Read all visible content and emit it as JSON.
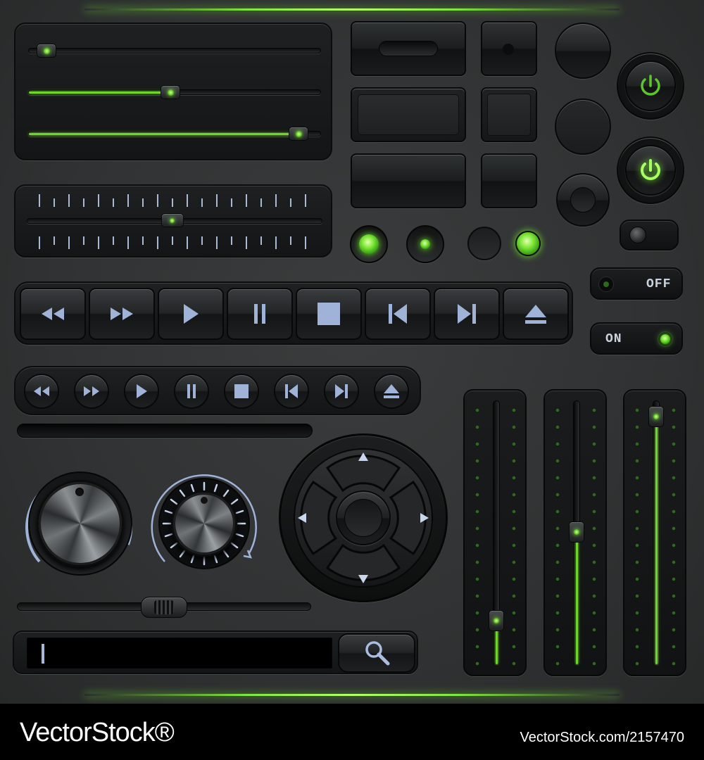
{
  "toggles": {
    "off_label": "OFF",
    "on_label": "ON"
  },
  "horizontal_sliders": [
    0.05,
    0.5,
    0.97
  ],
  "tick_slider_value": 0.5,
  "balance_slider_value": 0.45,
  "vertical_sliders": [
    0.15,
    0.5,
    0.97
  ],
  "search": {
    "value": "",
    "placeholder": ""
  },
  "transport_buttons": [
    "rewind",
    "fast-forward",
    "play",
    "pause",
    "stop",
    "skip-back",
    "skip-forward",
    "eject"
  ],
  "colors": {
    "accent": "#6fd52e",
    "icon": "#9fb3d8",
    "background": "#2e3031"
  },
  "footer": {
    "left": "VectorStock®",
    "right": "VectorStock.com/2157470"
  }
}
